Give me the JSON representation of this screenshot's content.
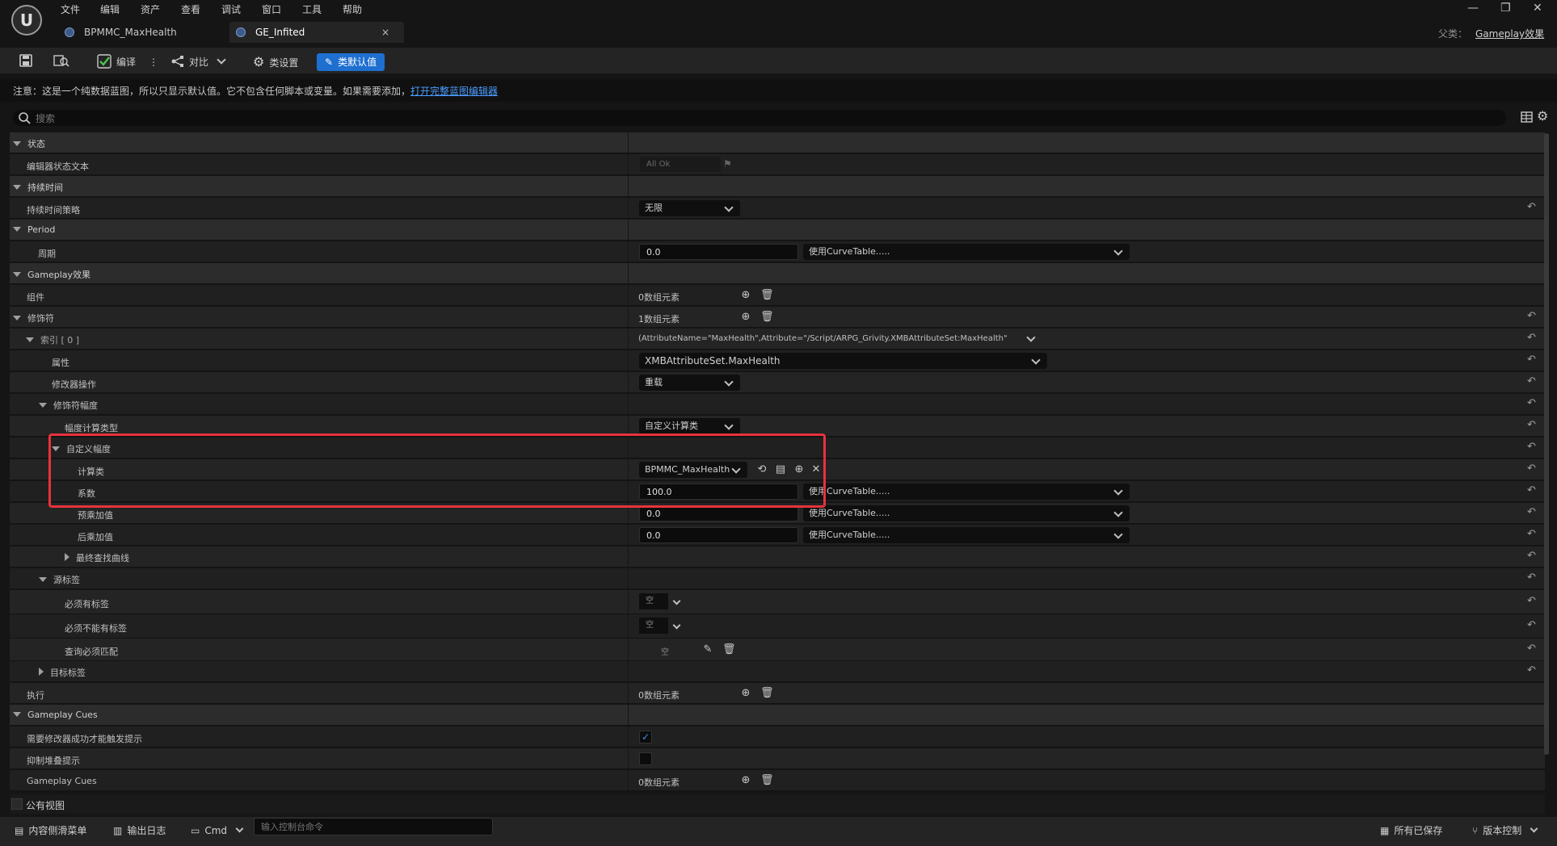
{
  "menu": {
    "logo": "U",
    "items": [
      "文件",
      "编辑",
      "资产",
      "查看",
      "调试",
      "窗口",
      "工具",
      "帮助"
    ]
  },
  "window_controls": {
    "minimize": "—",
    "restore": "❐",
    "close": "✕"
  },
  "tabs": [
    {
      "label": "BPMMC_MaxHealth"
    },
    {
      "label": "GE_Infited"
    }
  ],
  "parent": {
    "label": "父类：",
    "value": "Gameplay效果"
  },
  "toolbar": {
    "compile": "编译",
    "diff": "对比",
    "class_settings": "类设置",
    "class_defaults": "类默认值"
  },
  "notice": {
    "text": "注意：这是一个纯数据蓝图，所以只显示默认值。它不包含任何脚本或变量。如果需要添加，",
    "link": "打开完整蓝图编辑器"
  },
  "search": {
    "placeholder": "搜索"
  },
  "rows": {
    "state_cat": "状态",
    "editor_state_text": "编辑器状态文本",
    "editor_state_value": "All Ok",
    "duration_cat": "持续时间",
    "duration_policy": "持续时间策略",
    "duration_policy_value": "无限",
    "period_cat": "Period",
    "period": "周期",
    "period_value": "0.0",
    "curve_table": "使用CurveTable.....",
    "gameplay_effect_cat": "Gameplay效果",
    "components": "组件",
    "components_count": "0数组元素",
    "modifiers": "修饰符",
    "modifiers_count": "1数组元素",
    "index0": "索引 [ 0 ]",
    "index0_value": "(AttributeName=\"MaxHealth\",Attribute=\"/Script/ARPG_Grivity.XMBAttributeSet:MaxHealth\"",
    "attribute": "属性",
    "attribute_value": "XMBAttributeSet.MaxHealth",
    "modifier_op": "修改器操作",
    "modifier_op_value": "重载",
    "modifier_magnitude": "修饰符幅度",
    "magnitude_calc_type": "幅度计算类型",
    "magnitude_calc_type_value": "自定义计算类",
    "custom_magnitude": "自定义幅度",
    "calc_class": "计算类",
    "calc_class_value": "BPMMC_MaxHealth",
    "coefficient": "系数",
    "coefficient_value": "100.0",
    "pre_multiply": "预乘加值",
    "pre_multiply_value": "0.0",
    "post_multiply": "后乘加值",
    "post_multiply_value": "0.0",
    "final_lookup_curve": "最终查找曲线",
    "source_tags": "源标签",
    "must_have_tags": "必须有标签",
    "must_not_have_tags": "必须不能有标签",
    "query_must_match": "查询必须匹配",
    "empty": "空",
    "target_tags": "目标标签",
    "executions": "执行",
    "executions_count": "0数组元素",
    "gameplay_cues_cat": "Gameplay Cues",
    "require_modifier_success": "需要修改器成功才能触发提示",
    "suppress_stacking": "抑制堆叠提示",
    "gameplay_cues": "Gameplay Cues",
    "gameplay_cues_count": "0数组元素"
  },
  "public_view": "公有视图",
  "statusbar": {
    "content_drawer": "内容侧滑菜单",
    "output_log": "输出日志",
    "cmd": "Cmd",
    "cmd_placeholder": "输入控制台命令",
    "all_saved": "所有已保存",
    "source_control": "版本控制"
  },
  "colors": {
    "accent": "#1e6fd0",
    "highlight": "#e8323c",
    "link": "#4a9cff"
  }
}
